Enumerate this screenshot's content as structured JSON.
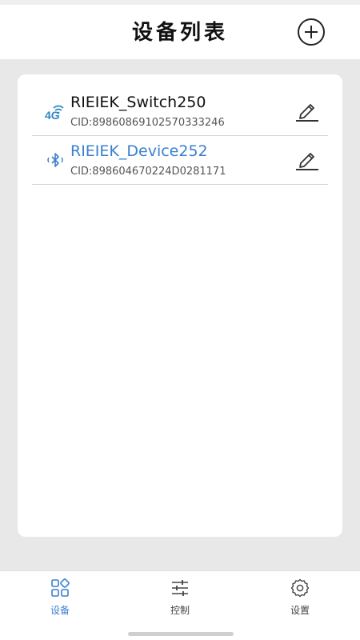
{
  "header": {
    "title": "设备列表",
    "add_icon": "plus-circle-icon"
  },
  "devices": [
    {
      "name": "RIEIEK_Switch250",
      "cid": "CID:89860869102570333246",
      "connection_label": "4G",
      "connection_icon": "4g-signal-icon",
      "active": false
    },
    {
      "name": "RIEIEK_Device252",
      "cid": "CID:898604670224D0281171",
      "connection_icon": "bluetooth-icon",
      "active": true
    }
  ],
  "tabs": [
    {
      "label": "设备",
      "icon": "grid-icon",
      "active": true
    },
    {
      "label": "控制",
      "icon": "sliders-icon",
      "active": false
    },
    {
      "label": "设置",
      "icon": "gear-icon",
      "active": false
    }
  ],
  "colors": {
    "accent": "#3a7fd0",
    "icon_4g": "#2f86c6",
    "background": "#e8e8e8"
  }
}
